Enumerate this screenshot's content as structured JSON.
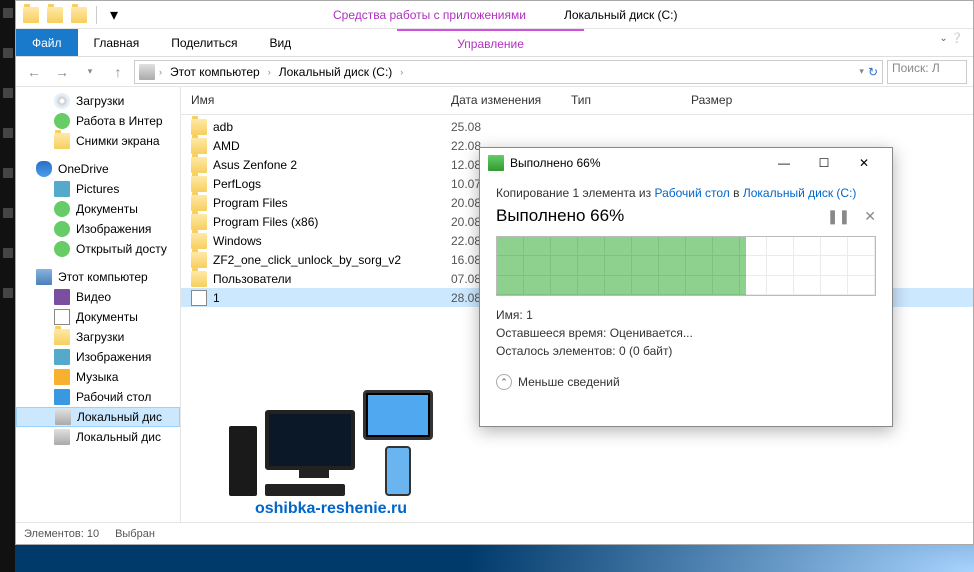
{
  "titlebar": {
    "app_tools": "Средства работы с приложениями",
    "window_title": "Локальный диск (C:)"
  },
  "ribbon": {
    "file": "Файл",
    "home": "Главная",
    "share": "Поделиться",
    "view": "Вид",
    "manage": "Управление"
  },
  "address": {
    "root": "Этот компьютер",
    "drive": "Локальный диск (C:)"
  },
  "search_placeholder": "Поиск: Л",
  "tree": [
    {
      "lvl": 2,
      "icon": "ic-disc",
      "label": "Загрузки"
    },
    {
      "lvl": 2,
      "icon": "ic-green",
      "label": "Работа в Интер"
    },
    {
      "lvl": 2,
      "icon": "ic-folder",
      "label": "Снимки экрана"
    },
    {
      "sep": true
    },
    {
      "lvl": 1,
      "icon": "ic-onedrive",
      "label": "OneDrive"
    },
    {
      "lvl": 2,
      "icon": "ic-pic",
      "label": "Pictures"
    },
    {
      "lvl": 2,
      "icon": "ic-green",
      "label": "Документы"
    },
    {
      "lvl": 2,
      "icon": "ic-green",
      "label": "Изображения"
    },
    {
      "lvl": 2,
      "icon": "ic-green",
      "label": "Открытый досту"
    },
    {
      "sep": true
    },
    {
      "lvl": 1,
      "icon": "ic-pc",
      "label": "Этот компьютер"
    },
    {
      "lvl": 2,
      "icon": "ic-video",
      "label": "Видео"
    },
    {
      "lvl": 2,
      "icon": "ic-file",
      "label": "Документы"
    },
    {
      "lvl": 2,
      "icon": "ic-folder",
      "label": "Загрузки"
    },
    {
      "lvl": 2,
      "icon": "ic-pic",
      "label": "Изображения"
    },
    {
      "lvl": 2,
      "icon": "ic-music",
      "label": "Музыка"
    },
    {
      "lvl": 2,
      "icon": "ic-desk",
      "label": "Рабочий стол"
    },
    {
      "lvl": 2,
      "icon": "ic-drive",
      "label": "Локальный дис",
      "sel": true
    },
    {
      "lvl": 2,
      "icon": "ic-drive",
      "label": "Локальный дис"
    }
  ],
  "columns": {
    "name": "Имя",
    "date": "Дата изменения",
    "type": "Тип",
    "size": "Размер"
  },
  "rows": [
    {
      "icon": "ic-folder",
      "name": "adb",
      "date": "25.08"
    },
    {
      "icon": "ic-folder",
      "name": "AMD",
      "date": "22.08"
    },
    {
      "icon": "ic-folder",
      "name": "Asus Zenfone 2",
      "date": "12.08"
    },
    {
      "icon": "ic-folder",
      "name": "PerfLogs",
      "date": "10.07"
    },
    {
      "icon": "ic-folder",
      "name": "Program Files",
      "date": "20.08"
    },
    {
      "icon": "ic-folder",
      "name": "Program Files (x86)",
      "date": "20.08"
    },
    {
      "icon": "ic-folder",
      "name": "Windows",
      "date": "22.08"
    },
    {
      "icon": "ic-folder",
      "name": "ZF2_one_click_unlock_by_sorg_v2",
      "date": "16.08"
    },
    {
      "icon": "ic-folder",
      "name": "Пользователи",
      "date": "07.08"
    },
    {
      "icon": "ic-file",
      "name": "1",
      "date": "28.08",
      "sel": true
    }
  ],
  "promo_url": "oshibka-reshenie.ru",
  "status": {
    "count": "Элементов: 10",
    "sel": "Выбран"
  },
  "dialog": {
    "title": "Выполнено 66%",
    "line1_a": "Копирование 1 элемента из ",
    "link1": "Рабочий стол",
    "line1_b": " в ",
    "link2": "Локальный диск (C:)",
    "line2": "Выполнено 66%",
    "percent": 66,
    "name_lbl": "Имя:",
    "name_val": "1",
    "time_lbl": "Оставшееся время:",
    "time_val": "Оценивается...",
    "rem_lbl": "Осталось элементов:",
    "rem_val": "0 (0 байт)",
    "more": "Меньше сведений"
  }
}
